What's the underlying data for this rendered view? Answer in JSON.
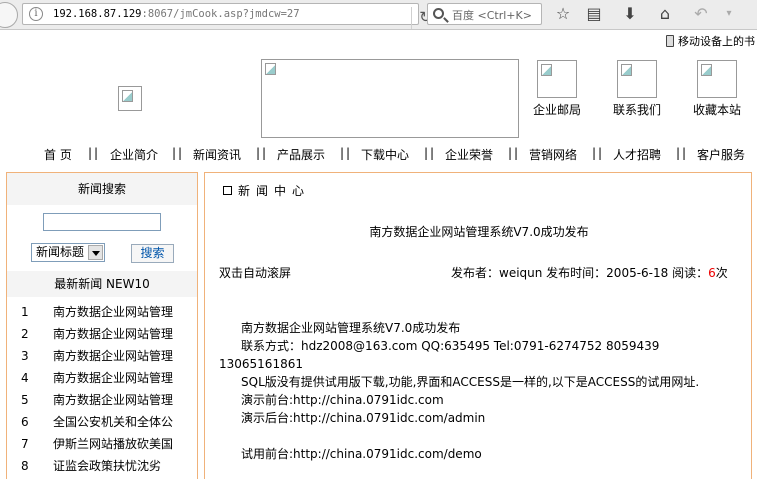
{
  "browser": {
    "url_host": "192.168.87.129",
    "url_rest": ":8067/jmCook.asp?jmdcw=27",
    "search_placeholder": "百度 <Ctrl+K>",
    "mobile_bookmarks": "移动设备上的书"
  },
  "header": {
    "quick_links": [
      "企业邮局",
      "联系我们",
      "收藏本站"
    ]
  },
  "nav": {
    "items": [
      "首 页",
      "企业简介",
      "新闻资讯",
      "产品展示",
      "下载中心",
      "企业荣誉",
      "营销网络",
      "人才招聘",
      "客户服务"
    ],
    "separator": "||"
  },
  "sidebar": {
    "search_title": "新闻搜索",
    "search_value": "",
    "select_value": "新闻标题",
    "search_button": "搜索",
    "latest_title": "最新新闻 NEW10",
    "news": [
      {
        "num": "1",
        "title": "南方数据企业网站管理"
      },
      {
        "num": "2",
        "title": "南方数据企业网站管理"
      },
      {
        "num": "3",
        "title": "南方数据企业网站管理"
      },
      {
        "num": "4",
        "title": "南方数据企业网站管理"
      },
      {
        "num": "5",
        "title": "南方数据企业网站管理"
      },
      {
        "num": "6",
        "title": "全国公安机关和全体公"
      },
      {
        "num": "7",
        "title": "伊斯兰网站播放砍美国"
      },
      {
        "num": "8",
        "title": "证监会政策扶忧沈劣"
      }
    ]
  },
  "main": {
    "section_title": "新闻中心",
    "article_title": "南方数据企业网站管理系统V7.0成功发布",
    "scroll_hint": "双击自动滚屏",
    "meta_prefix": "发布者：weiqun 发布时间：2005-6-18 阅读：",
    "read_count": "6",
    "read_suffix": "次",
    "body": {
      "line1": "南方数据企业网站管理系统V7.0成功发布",
      "line2": "联系方式：hdz2008@163.com QQ:635495 Tel:0791-6274752  8059439",
      "line3": "13065161861",
      "line4": "SQL版没有提供试用版下载,功能,界面和ACCESS是一样的,以下是ACCESS的试用网址.",
      "line5": "演示前台:http://china.0791idc.com",
      "line6": "演示后台:http://china.0791idc.com/admin",
      "line7": "试用前台:http://china.0791idc.com/demo"
    }
  }
}
